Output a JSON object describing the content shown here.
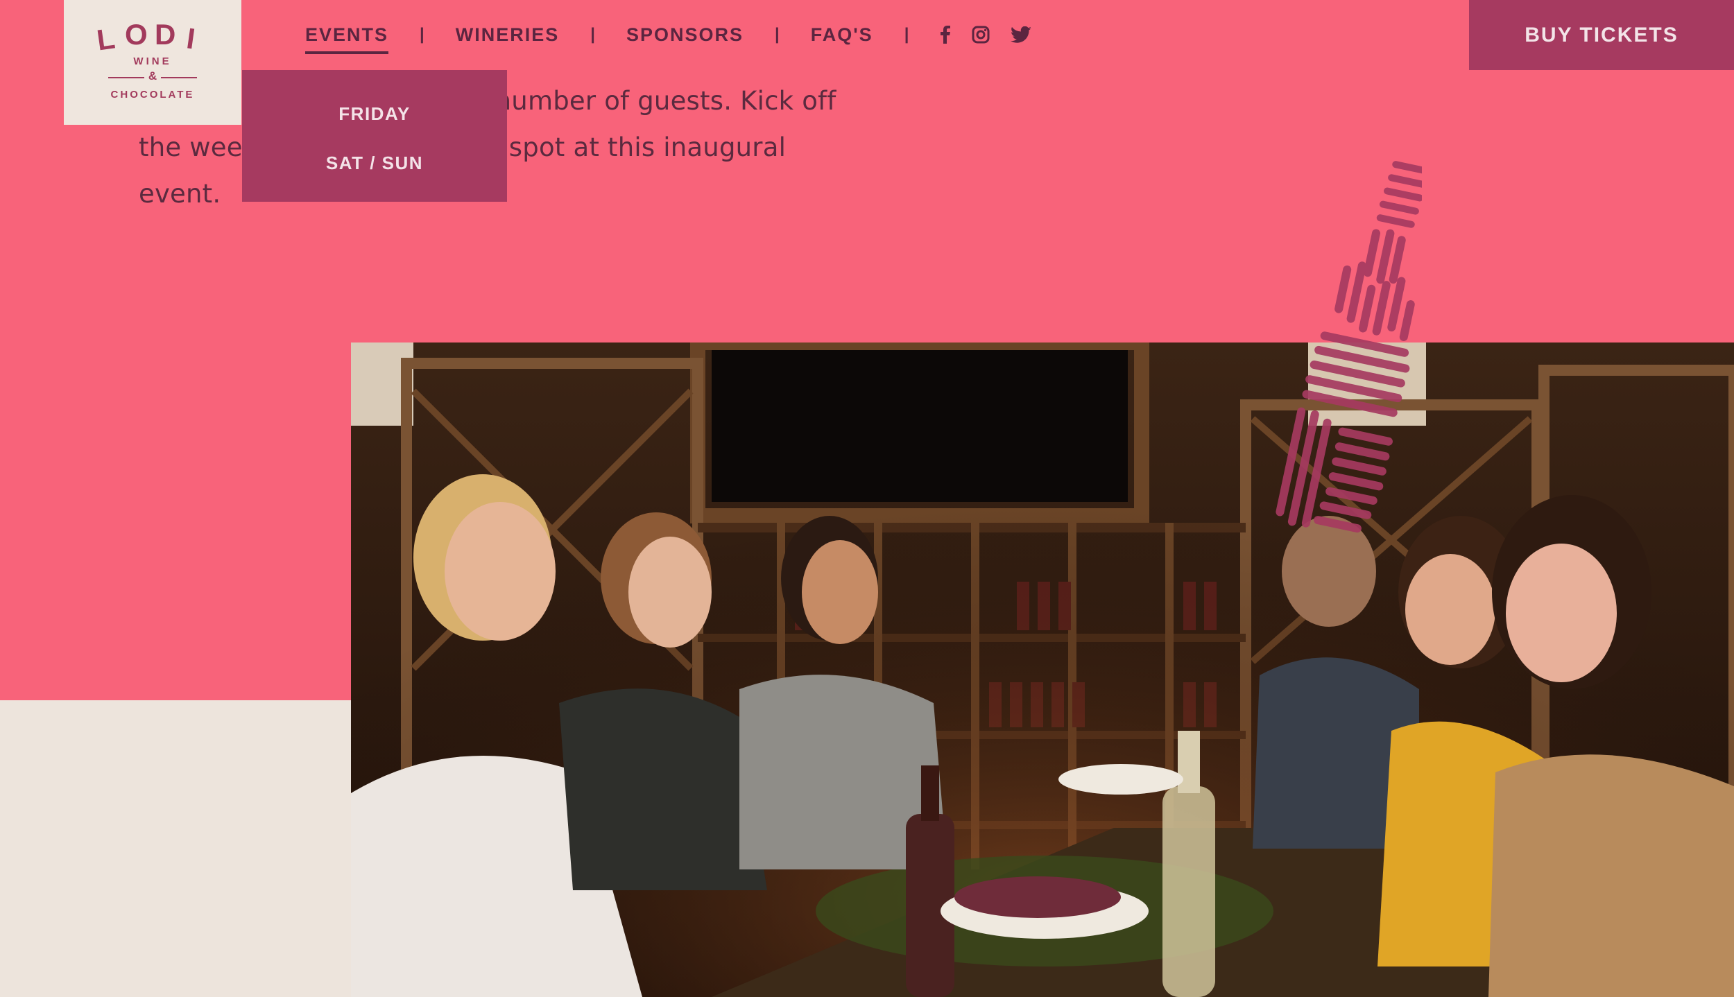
{
  "logo": {
    "name": "LODI",
    "line1": "WINE",
    "amp": "&",
    "line2": "CHOCOLATE"
  },
  "nav": {
    "items": [
      {
        "label": "EVENTS",
        "active": true
      },
      {
        "label": "WINERIES",
        "active": false
      },
      {
        "label": "SPONSORS",
        "active": false
      },
      {
        "label": "FAQ'S",
        "active": false
      }
    ],
    "separator": "|",
    "social_icons": [
      "facebook-icon",
      "instagram-icon",
      "twitter-icon"
    ]
  },
  "buy_tickets_label": "BUY TICKETS",
  "events_dropdown": {
    "items": [
      "FRIDAY",
      "SAT / SUN"
    ]
  },
  "intro": {
    "line1_visible": "d number of guests. Kick off",
    "line2_left": "the wee",
    "line2_right": "ng a spot at this inaugural",
    "line3": "event."
  },
  "colors": {
    "background": "#f8637a",
    "accent": "#a63a60",
    "cream": "#ede4dc",
    "text": "#5b2540"
  }
}
